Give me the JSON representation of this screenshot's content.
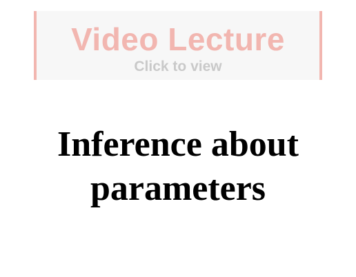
{
  "video": {
    "title": "Video Lecture",
    "subtitle": "Click to view",
    "accent_color": "#f2b6b0"
  },
  "heading": {
    "line1": "Inference about",
    "line2": "parameters"
  }
}
